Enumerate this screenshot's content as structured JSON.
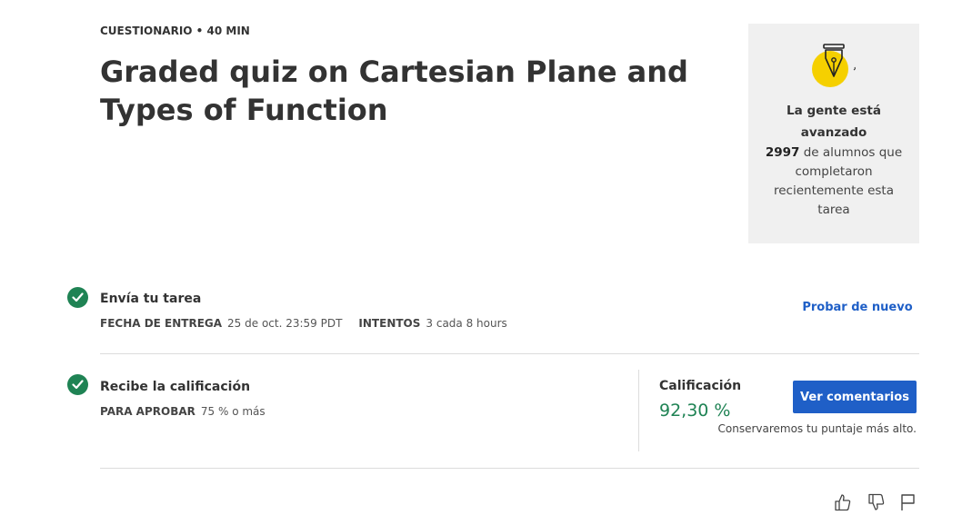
{
  "header": {
    "eyebrow": "CUESTIONARIO • 40 MIN",
    "title": "Graded quiz on Cartesian Plane and Types of Function"
  },
  "progress_card": {
    "icon": "fountain-pen-icon",
    "heading": "La gente está avanzado",
    "count": "2997",
    "text": "de alumnos que completaron recientemente esta tarea"
  },
  "steps": [
    {
      "icon": "check-icon",
      "title": "Envía tu tarea",
      "meta": [
        {
          "label": "FECHA DE ENTREGA",
          "value": "25 de oct. 23:59 PDT"
        },
        {
          "label": "INTENTOS",
          "value": "3 cada 8 hours"
        }
      ],
      "action_label": "Probar de nuevo"
    },
    {
      "icon": "check-icon",
      "title": "Recibe la calificación",
      "meta": [
        {
          "label": "PARA APROBAR",
          "value": "75 % o más"
        }
      ]
    }
  ],
  "grade": {
    "label": "Calificación",
    "value": "92,30 %",
    "button_label": "Ver comentarios",
    "note": "Conservaremos tu puntaje más alto."
  },
  "feedback": {
    "like_icon": "thumbs-up-icon",
    "dislike_icon": "thumbs-down-icon",
    "report_icon": "flag-icon"
  },
  "colors": {
    "accent": "#1f5fc7",
    "success": "#1f8354",
    "highlight": "#f5d000",
    "card_bg": "#f0f0f0"
  }
}
